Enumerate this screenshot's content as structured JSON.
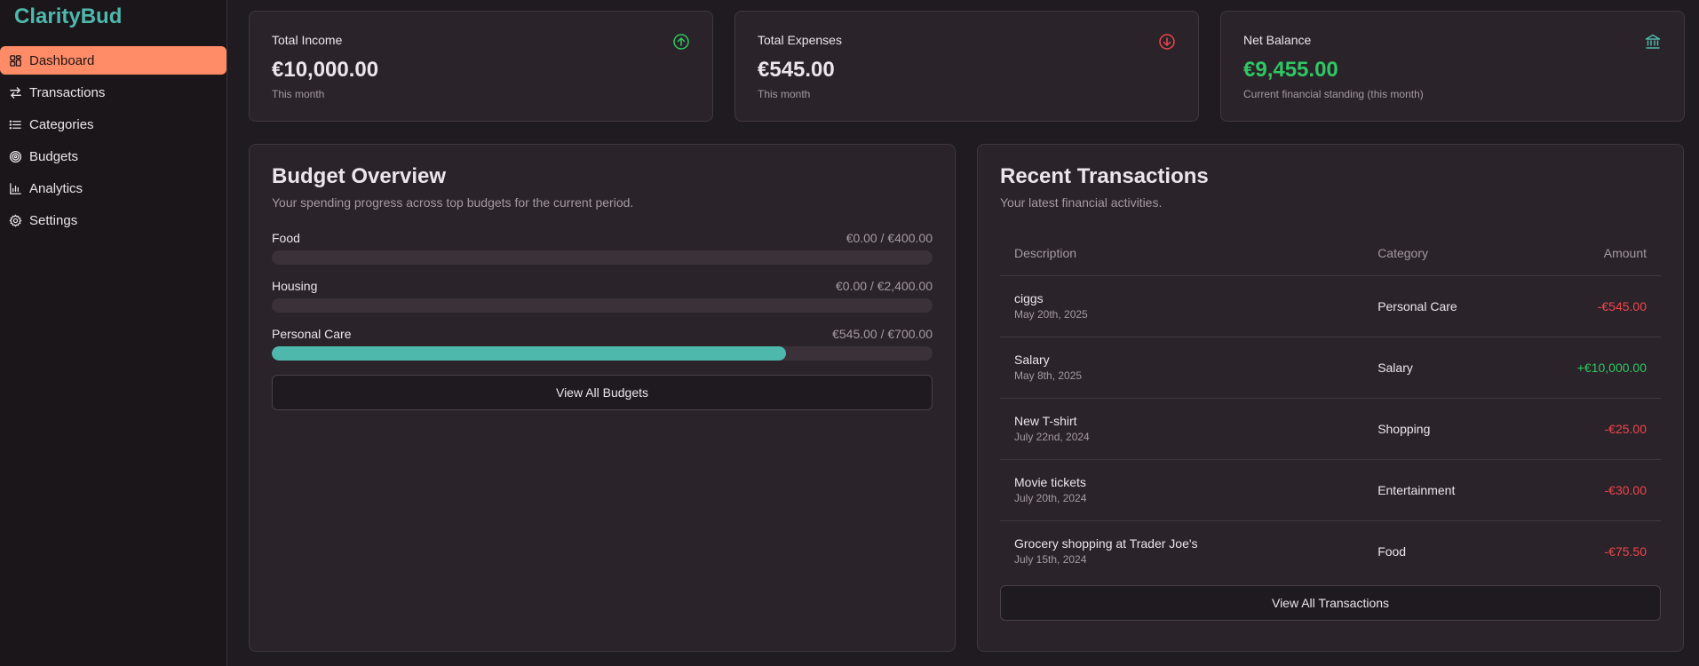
{
  "brand": "ClarityBud",
  "nav": [
    {
      "label": "Dashboard",
      "icon": "dashboard-icon",
      "active": true
    },
    {
      "label": "Transactions",
      "icon": "arrows-left-right-icon",
      "active": false
    },
    {
      "label": "Categories",
      "icon": "list-icon",
      "active": false
    },
    {
      "label": "Budgets",
      "icon": "target-icon",
      "active": false
    },
    {
      "label": "Analytics",
      "icon": "bar-chart-icon",
      "active": false
    },
    {
      "label": "Settings",
      "icon": "gear-icon",
      "active": false
    }
  ],
  "stats": [
    {
      "title": "Total Income",
      "value": "€10,000.00",
      "sub": "This month",
      "icon": "arrow-up-circle-icon",
      "icon_color": "#2fc763"
    },
    {
      "title": "Total Expenses",
      "value": "€545.00",
      "sub": "This month",
      "icon": "arrow-down-circle-icon",
      "icon_color": "#f0454d"
    },
    {
      "title": "Net Balance",
      "value": "€9,455.00",
      "sub": "Current financial standing (this month)",
      "icon": "bank-icon",
      "icon_color": "#4fb8ac",
      "value_color": "#2fc763"
    }
  ],
  "budget_overview": {
    "title": "Budget Overview",
    "description": "Your spending progress across top budgets for the current period.",
    "items": [
      {
        "name": "Food",
        "amount": "€0.00 / €400.00",
        "progress": 0
      },
      {
        "name": "Housing",
        "amount": "€0.00 / €2,400.00",
        "progress": 0
      },
      {
        "name": "Personal Care",
        "amount": "€545.00 / €700.00",
        "progress": 0.7786
      }
    ],
    "button": "View All Budgets"
  },
  "recent_transactions": {
    "title": "Recent Transactions",
    "description": "Your latest financial activities.",
    "columns": [
      "Description",
      "Category",
      "Amount"
    ],
    "rows": [
      {
        "description": "ciggs",
        "date": "May 20th, 2025",
        "category": "Personal Care",
        "amount": "-€545.00",
        "type": "expense"
      },
      {
        "description": "Salary",
        "date": "May 8th, 2025",
        "category": "Salary",
        "amount": "+€10,000.00",
        "type": "income"
      },
      {
        "description": "New T-shirt",
        "date": "July 22nd, 2024",
        "category": "Shopping",
        "amount": "-€25.00",
        "type": "expense"
      },
      {
        "description": "Movie tickets",
        "date": "July 20th, 2024",
        "category": "Entertainment",
        "amount": "-€30.00",
        "type": "expense"
      },
      {
        "description": "Grocery shopping at Trader Joe's",
        "date": "July 15th, 2024",
        "category": "Food",
        "amount": "-€75.50",
        "type": "expense"
      }
    ],
    "button": "View All Transactions"
  },
  "colors": {
    "accent": "#ff8c66",
    "brand": "#4fb8ac",
    "income": "#2fc763",
    "expense": "#f0454d"
  }
}
